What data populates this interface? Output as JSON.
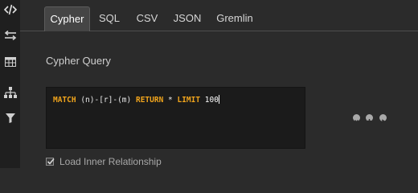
{
  "sidebar": {
    "icons": [
      "code-icon",
      "exchange-icon",
      "table-icon",
      "hierarchy-icon",
      "filter-icon"
    ]
  },
  "tabs": [
    {
      "label": "Cypher",
      "active": true
    },
    {
      "label": "SQL",
      "active": false
    },
    {
      "label": "CSV",
      "active": false
    },
    {
      "label": "JSON",
      "active": false
    },
    {
      "label": "Gremlin",
      "active": false
    }
  ],
  "main": {
    "section_title": "Cypher Query",
    "query": {
      "kw_match": "MATCH",
      "pattern": " (n)-[r]-(m) ",
      "kw_return": "RETURN",
      "star": " * ",
      "kw_limit": "LIMIT",
      "limit_value": " 100"
    },
    "controls": [
      "chevron-down-icon",
      "plus-icon",
      "play-icon"
    ],
    "load_inner_label": "Load Inner Relationship",
    "load_inner_checked": true
  },
  "colors": {
    "keyword": "#f0a41c",
    "background": "#2b2b2b",
    "editor_bg": "#1b1b1b"
  }
}
